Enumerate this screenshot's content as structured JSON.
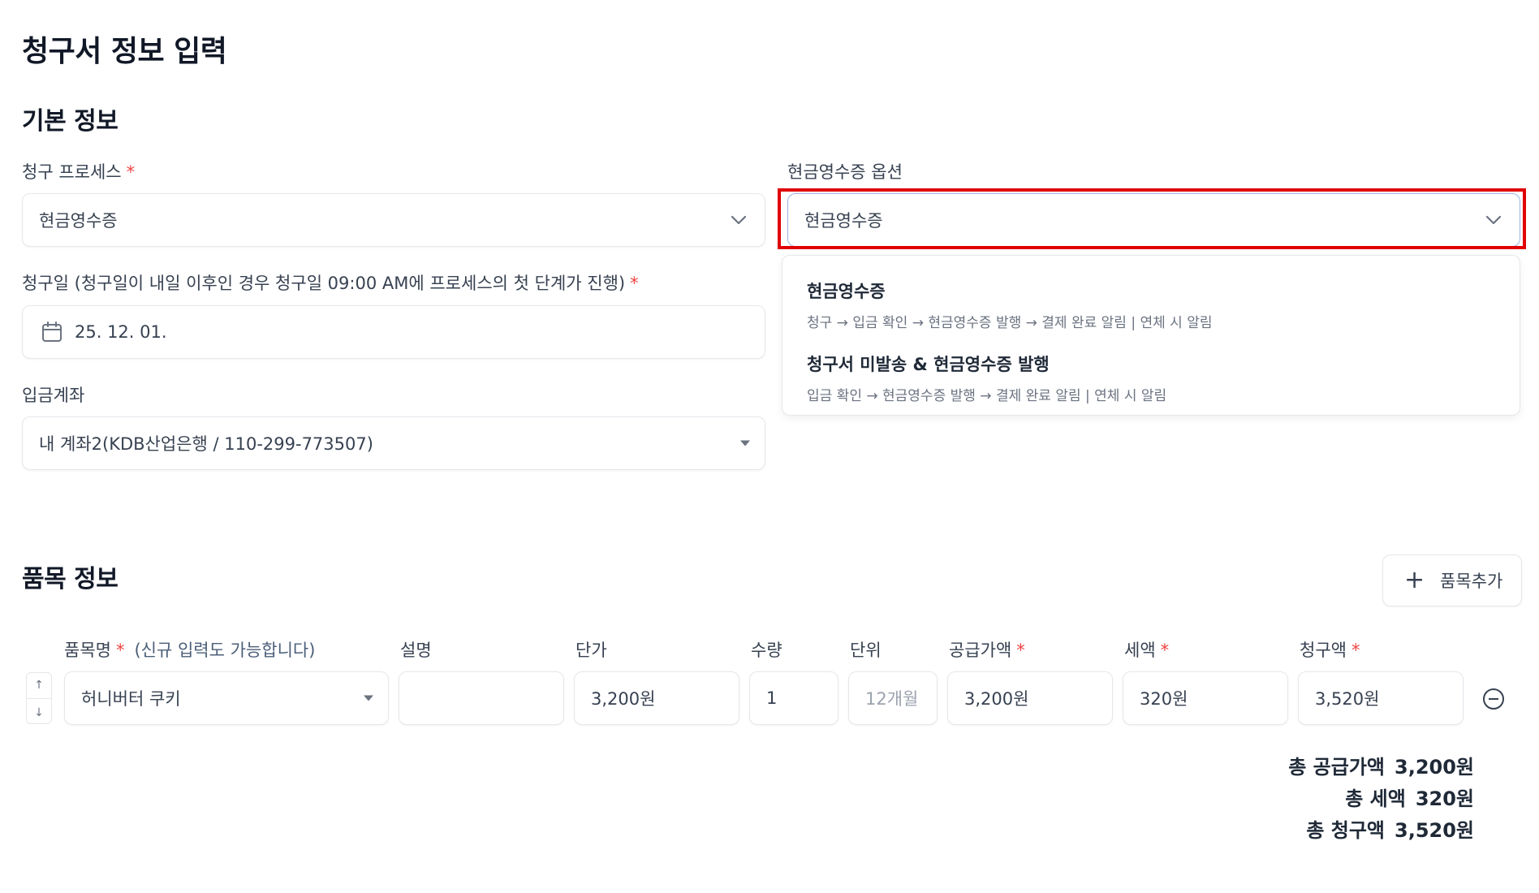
{
  "page_title": "청구서 정보 입력",
  "basic_section": {
    "title": "기본 정보",
    "billing_process": {
      "label": "청구 프로세스",
      "required_mark": "*",
      "value": "현금영수증"
    },
    "receipt_option": {
      "label": "현금영수증 옵션",
      "value": "현금영수증",
      "options": [
        {
          "title": "현금영수증",
          "desc": "청구 → 입금 확인 → 현금영수증 발행 → 결제 완료 알림  |  연체 시 알림"
        },
        {
          "title": "청구서 미발송 & 현금영수증 발행",
          "desc": "입금 확인 → 현금영수증 발행 → 결제 완료 알림  |  연체 시 알림"
        }
      ]
    },
    "billing_date": {
      "label": "청구일 (청구일이 내일 이후인 경우 청구일 09:00 AM에 프로세스의 첫 단계가 진행)",
      "required_mark": "*",
      "value": "25. 12. 01."
    },
    "deposit_account": {
      "label": "입금계좌",
      "value": "내 계좌2(KDB산업은행 / 110-299-773507)"
    }
  },
  "items_section": {
    "title": "품목 정보",
    "add_button_label": "품목추가",
    "columns": {
      "name": "품목명",
      "name_hint": "(신규 입력도 가능합니다)",
      "description": "설명",
      "unit_price": "단가",
      "quantity": "수량",
      "unit": "단위",
      "supply_amount": "공급가액",
      "tax": "세액",
      "billing_amount": "청구액",
      "required_mark": "*"
    },
    "rows": [
      {
        "name": "허니버터 쿠키",
        "description": "",
        "unit_price": "3,200원",
        "quantity": "1",
        "unit": "12개월",
        "supply_amount": "3,200원",
        "tax": "320원",
        "billing_amount": "3,520원"
      }
    ],
    "move_up": "↑",
    "move_down": "↓"
  },
  "totals": [
    {
      "label": "총 공급가액",
      "value": "3,200원"
    },
    {
      "label": "총 세액",
      "value": "320원"
    },
    {
      "label": "총 청구액",
      "value": "3,520원"
    }
  ],
  "colors": {
    "required": "#ef4444",
    "highlight": "#e00000",
    "hint": "#4b5e78"
  }
}
